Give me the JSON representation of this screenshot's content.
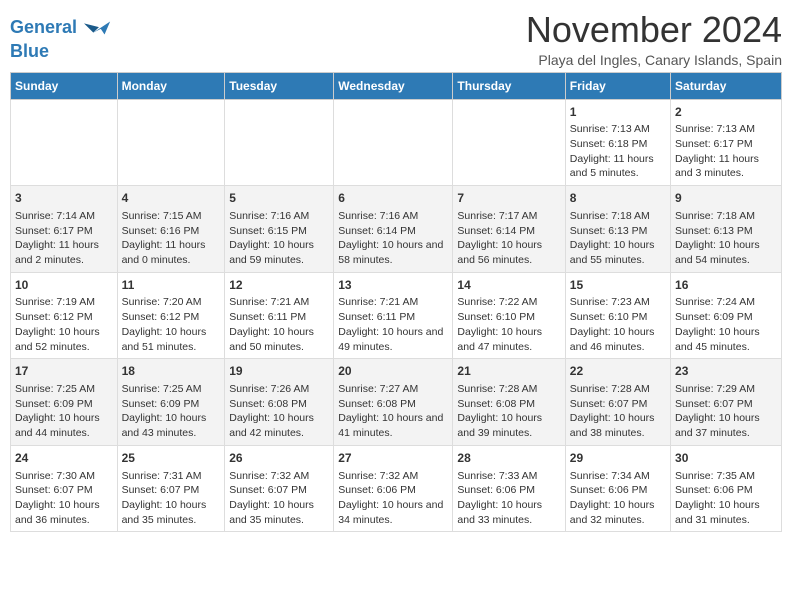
{
  "header": {
    "logo_line1": "General",
    "logo_line2": "Blue",
    "month_title": "November 2024",
    "subtitle": "Playa del Ingles, Canary Islands, Spain"
  },
  "days_of_week": [
    "Sunday",
    "Monday",
    "Tuesday",
    "Wednesday",
    "Thursday",
    "Friday",
    "Saturday"
  ],
  "weeks": [
    [
      {
        "day": "",
        "info": ""
      },
      {
        "day": "",
        "info": ""
      },
      {
        "day": "",
        "info": ""
      },
      {
        "day": "",
        "info": ""
      },
      {
        "day": "",
        "info": ""
      },
      {
        "day": "1",
        "info": "Sunrise: 7:13 AM\nSunset: 6:18 PM\nDaylight: 11 hours and 5 minutes."
      },
      {
        "day": "2",
        "info": "Sunrise: 7:13 AM\nSunset: 6:17 PM\nDaylight: 11 hours and 3 minutes."
      }
    ],
    [
      {
        "day": "3",
        "info": "Sunrise: 7:14 AM\nSunset: 6:17 PM\nDaylight: 11 hours and 2 minutes."
      },
      {
        "day": "4",
        "info": "Sunrise: 7:15 AM\nSunset: 6:16 PM\nDaylight: 11 hours and 0 minutes."
      },
      {
        "day": "5",
        "info": "Sunrise: 7:16 AM\nSunset: 6:15 PM\nDaylight: 10 hours and 59 minutes."
      },
      {
        "day": "6",
        "info": "Sunrise: 7:16 AM\nSunset: 6:14 PM\nDaylight: 10 hours and 58 minutes."
      },
      {
        "day": "7",
        "info": "Sunrise: 7:17 AM\nSunset: 6:14 PM\nDaylight: 10 hours and 56 minutes."
      },
      {
        "day": "8",
        "info": "Sunrise: 7:18 AM\nSunset: 6:13 PM\nDaylight: 10 hours and 55 minutes."
      },
      {
        "day": "9",
        "info": "Sunrise: 7:18 AM\nSunset: 6:13 PM\nDaylight: 10 hours and 54 minutes."
      }
    ],
    [
      {
        "day": "10",
        "info": "Sunrise: 7:19 AM\nSunset: 6:12 PM\nDaylight: 10 hours and 52 minutes."
      },
      {
        "day": "11",
        "info": "Sunrise: 7:20 AM\nSunset: 6:12 PM\nDaylight: 10 hours and 51 minutes."
      },
      {
        "day": "12",
        "info": "Sunrise: 7:21 AM\nSunset: 6:11 PM\nDaylight: 10 hours and 50 minutes."
      },
      {
        "day": "13",
        "info": "Sunrise: 7:21 AM\nSunset: 6:11 PM\nDaylight: 10 hours and 49 minutes."
      },
      {
        "day": "14",
        "info": "Sunrise: 7:22 AM\nSunset: 6:10 PM\nDaylight: 10 hours and 47 minutes."
      },
      {
        "day": "15",
        "info": "Sunrise: 7:23 AM\nSunset: 6:10 PM\nDaylight: 10 hours and 46 minutes."
      },
      {
        "day": "16",
        "info": "Sunrise: 7:24 AM\nSunset: 6:09 PM\nDaylight: 10 hours and 45 minutes."
      }
    ],
    [
      {
        "day": "17",
        "info": "Sunrise: 7:25 AM\nSunset: 6:09 PM\nDaylight: 10 hours and 44 minutes."
      },
      {
        "day": "18",
        "info": "Sunrise: 7:25 AM\nSunset: 6:09 PM\nDaylight: 10 hours and 43 minutes."
      },
      {
        "day": "19",
        "info": "Sunrise: 7:26 AM\nSunset: 6:08 PM\nDaylight: 10 hours and 42 minutes."
      },
      {
        "day": "20",
        "info": "Sunrise: 7:27 AM\nSunset: 6:08 PM\nDaylight: 10 hours and 41 minutes."
      },
      {
        "day": "21",
        "info": "Sunrise: 7:28 AM\nSunset: 6:08 PM\nDaylight: 10 hours and 39 minutes."
      },
      {
        "day": "22",
        "info": "Sunrise: 7:28 AM\nSunset: 6:07 PM\nDaylight: 10 hours and 38 minutes."
      },
      {
        "day": "23",
        "info": "Sunrise: 7:29 AM\nSunset: 6:07 PM\nDaylight: 10 hours and 37 minutes."
      }
    ],
    [
      {
        "day": "24",
        "info": "Sunrise: 7:30 AM\nSunset: 6:07 PM\nDaylight: 10 hours and 36 minutes."
      },
      {
        "day": "25",
        "info": "Sunrise: 7:31 AM\nSunset: 6:07 PM\nDaylight: 10 hours and 35 minutes."
      },
      {
        "day": "26",
        "info": "Sunrise: 7:32 AM\nSunset: 6:07 PM\nDaylight: 10 hours and 35 minutes."
      },
      {
        "day": "27",
        "info": "Sunrise: 7:32 AM\nSunset: 6:06 PM\nDaylight: 10 hours and 34 minutes."
      },
      {
        "day": "28",
        "info": "Sunrise: 7:33 AM\nSunset: 6:06 PM\nDaylight: 10 hours and 33 minutes."
      },
      {
        "day": "29",
        "info": "Sunrise: 7:34 AM\nSunset: 6:06 PM\nDaylight: 10 hours and 32 minutes."
      },
      {
        "day": "30",
        "info": "Sunrise: 7:35 AM\nSunset: 6:06 PM\nDaylight: 10 hours and 31 minutes."
      }
    ]
  ]
}
